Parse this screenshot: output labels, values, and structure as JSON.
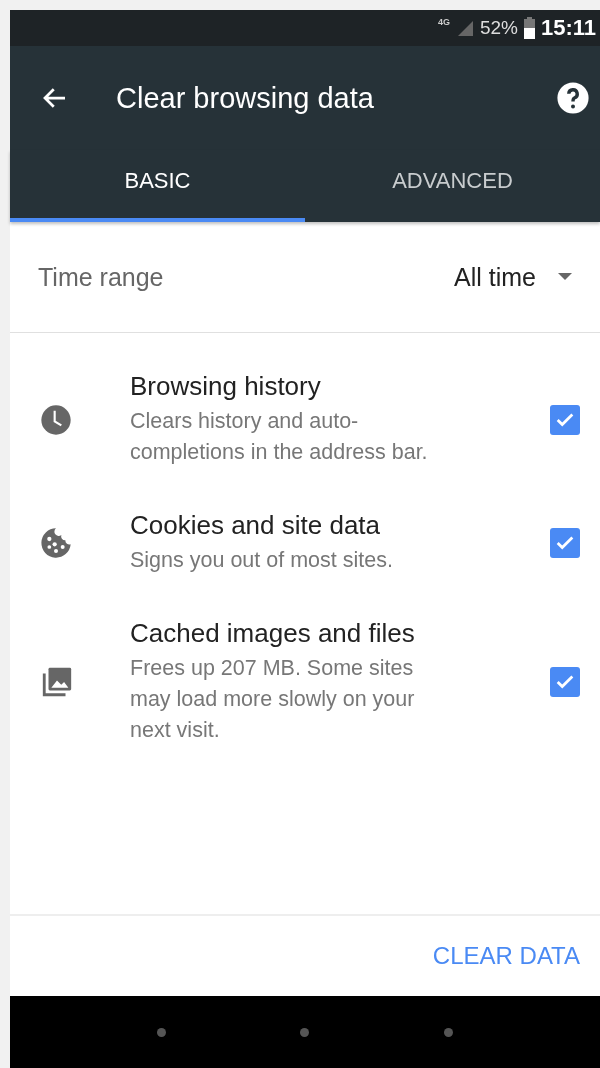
{
  "status_bar": {
    "network": "4G",
    "battery": "52%",
    "time": "15:11"
  },
  "toolbar": {
    "title": "Clear browsing data"
  },
  "tabs": [
    {
      "label": "BASIC",
      "selected": true
    },
    {
      "label": "ADVANCED",
      "selected": false
    }
  ],
  "time_range": {
    "label": "Time range",
    "value": "All time"
  },
  "items": [
    {
      "kind": "history",
      "title": "Browsing history",
      "description": "Clears history and auto-completions in the address bar.",
      "checked": true
    },
    {
      "kind": "cookies",
      "title": "Cookies and site data",
      "description": "Signs you out of most sites.",
      "checked": true
    },
    {
      "kind": "images",
      "title": "Cached images and files",
      "description": "Frees up 207 MB. Some sites may load more slowly on your next visit.",
      "checked": true
    }
  ],
  "action": "CLEAR DATA"
}
